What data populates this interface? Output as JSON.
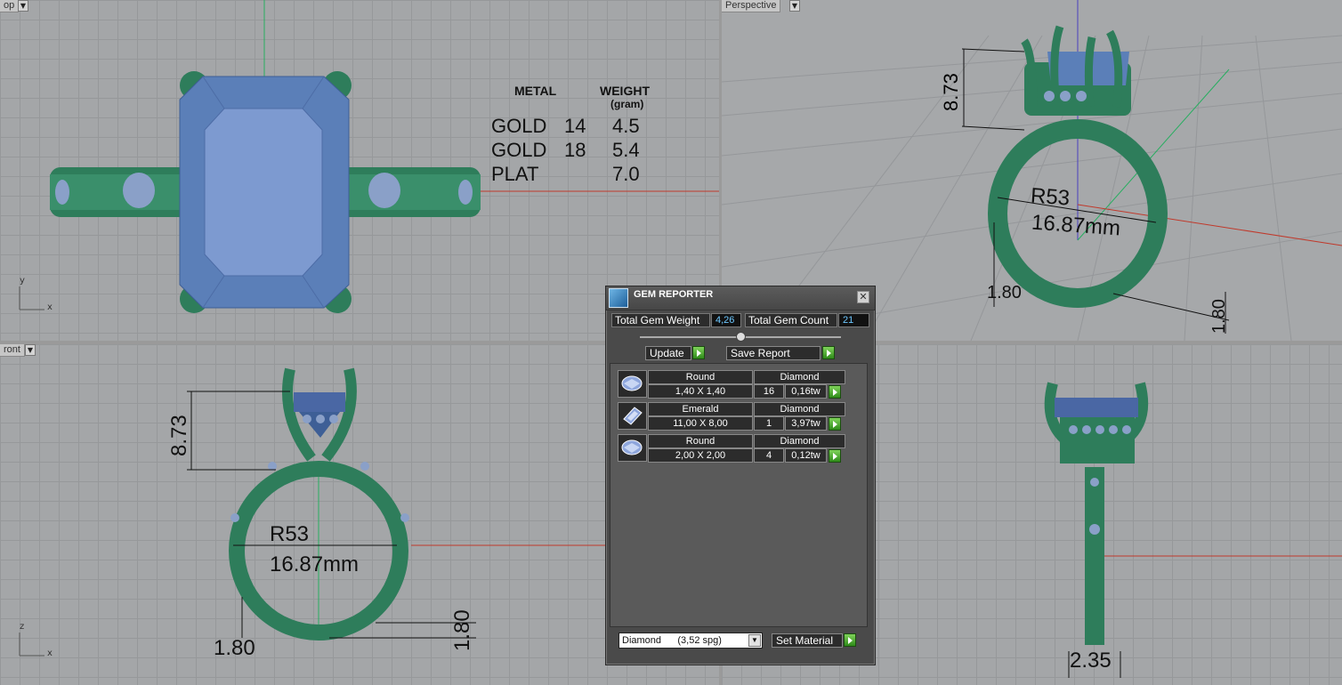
{
  "viewports": {
    "top": {
      "label": "op"
    },
    "perspective": {
      "label": "Perspective"
    },
    "front": {
      "label": "ront"
    },
    "axes": {
      "x": "x",
      "y": "y",
      "z": "z"
    }
  },
  "weight_table": {
    "col_metal": "METAL",
    "col_weight": "WEIGHT",
    "col_weight_unit": "(gram)",
    "rows": [
      {
        "metal": "GOLD",
        "karat": "14",
        "weight": "4.5"
      },
      {
        "metal": "GOLD",
        "karat": "18",
        "weight": "5.4"
      },
      {
        "metal": "PLAT",
        "karat": "",
        "weight": "7.0"
      }
    ]
  },
  "dimensions": {
    "height": "8.73",
    "size": "R53",
    "diameter": "16.87mm",
    "band_thickness": "1.80",
    "band_width_side": "1.80",
    "shank_width": "2.35"
  },
  "gem_reporter": {
    "title": "GEM REPORTER",
    "total_weight_label": "Total Gem Weight",
    "total_weight_value": "4,26",
    "total_count_label": "Total Gem Count",
    "total_count_value": "21",
    "update_label": "Update",
    "save_label": "Save Report",
    "gems": [
      {
        "cut": "Round",
        "material": "Diamond",
        "size": "1,40 X 1,40",
        "count": "16",
        "weight": "0,16tw"
      },
      {
        "cut": "Emerald",
        "material": "Diamond",
        "size": "11,00 X 8,00",
        "count": "1",
        "weight": "3,97tw"
      },
      {
        "cut": "Round",
        "material": "Diamond",
        "size": "2,00 X 2,00",
        "count": "4",
        "weight": "0,12tw"
      }
    ],
    "material_select": "Diamond      (3,52 spg)",
    "set_material_label": "Set Material"
  },
  "colors": {
    "metal": "#2e7d5b",
    "gem": "#5b7fb8",
    "axis_x": "#c0392b",
    "axis_y": "#27ae60",
    "axis_z": "#4a3fbf"
  }
}
